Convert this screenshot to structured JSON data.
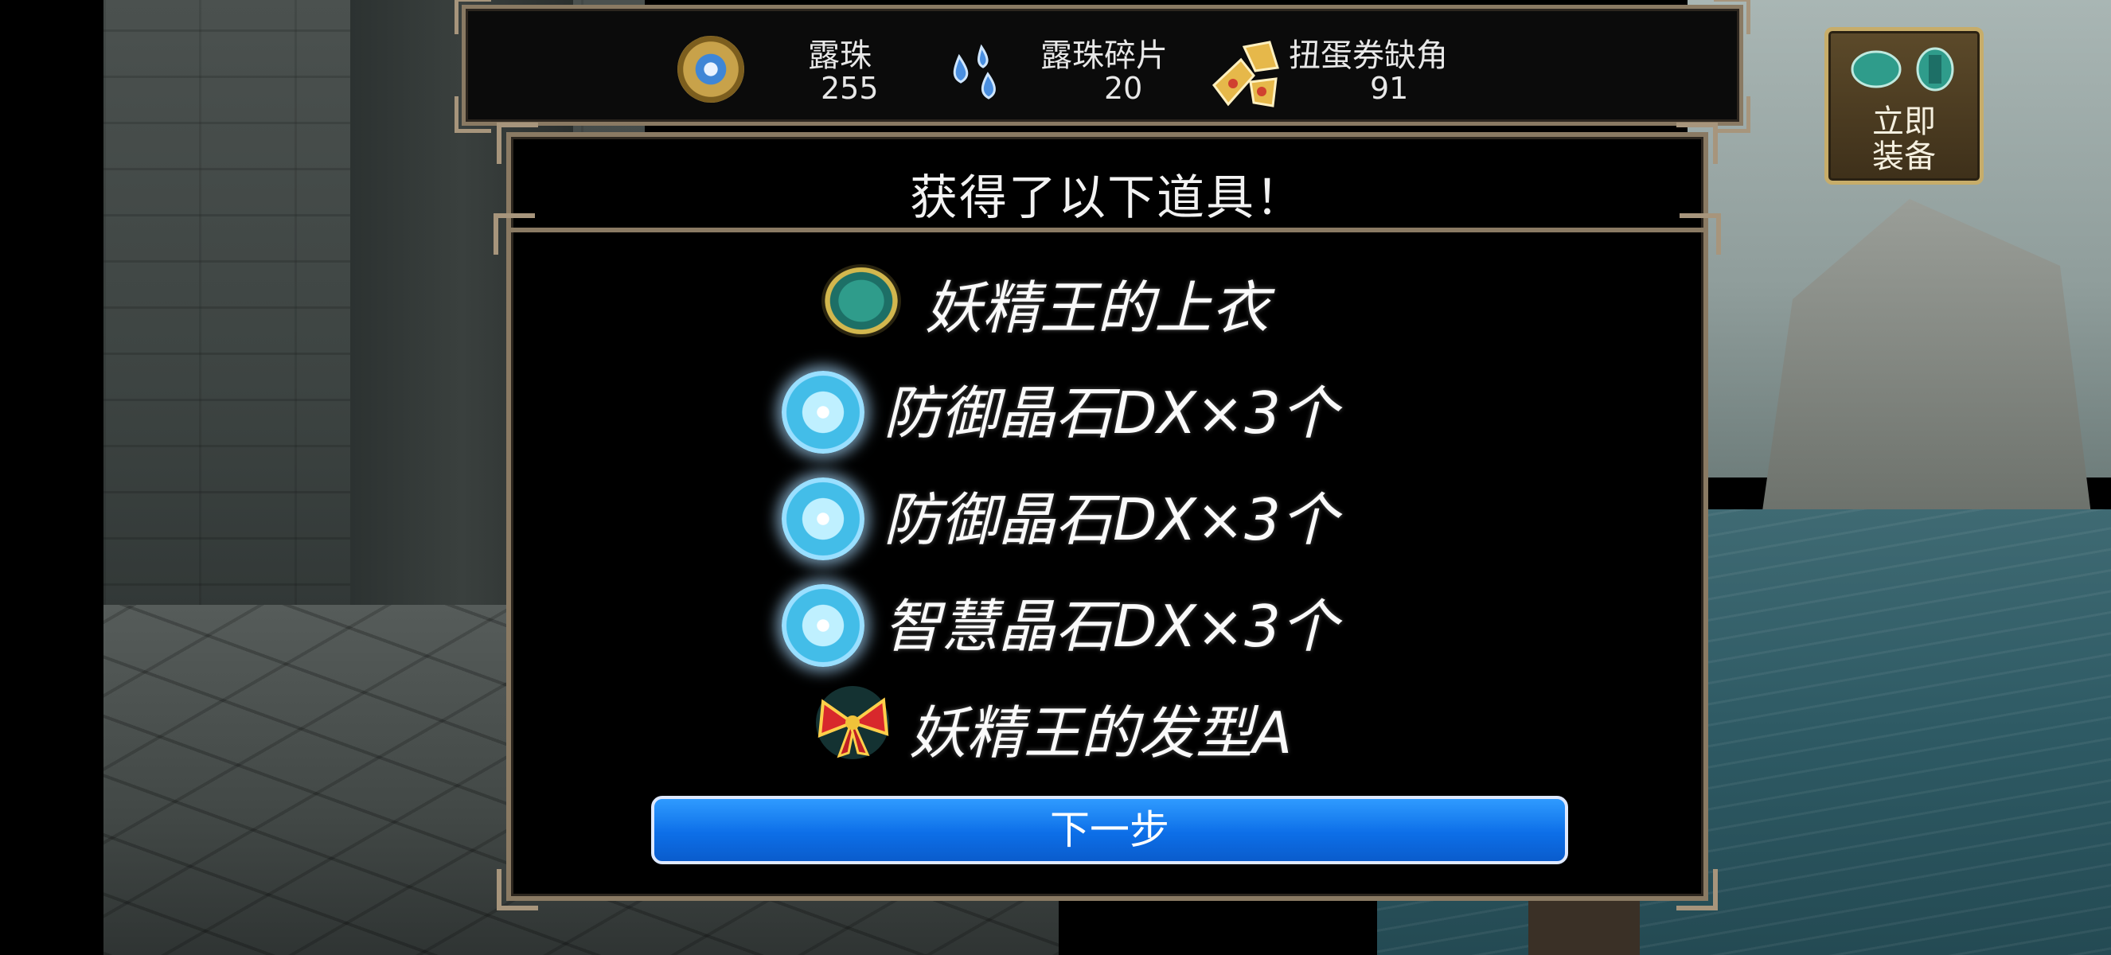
{
  "resources": [
    {
      "name": "露珠",
      "value": "255",
      "icon": "dew-pearl-icon"
    },
    {
      "name": "露珠碎片",
      "value": "20",
      "icon": "dew-shard-icon"
    },
    {
      "name": "扭蛋券缺角",
      "value": "91",
      "icon": "gacha-ticket-fragment-icon"
    }
  ],
  "dialog": {
    "title": "获得了以下道具！",
    "items": [
      {
        "label": "妖精王的上衣",
        "icon": "armor-icon"
      },
      {
        "label": "防御晶石DX×3个",
        "icon": "crystal-icon"
      },
      {
        "label": "防御晶石DX×3个",
        "icon": "crystal-icon"
      },
      {
        "label": "智慧晶石DX×3个",
        "icon": "crystal-icon"
      },
      {
        "label": "妖精王的发型A",
        "icon": "hair-bow-icon"
      }
    ],
    "next_label": "下一步"
  },
  "equip": {
    "label": "立即\n装备",
    "icon": "armor-set-icon"
  },
  "colors": {
    "frame": "#8a7a63",
    "button_blue": "#0d6fe8",
    "gem_blue": "#43bde8",
    "gold": "#c7ad6a"
  }
}
